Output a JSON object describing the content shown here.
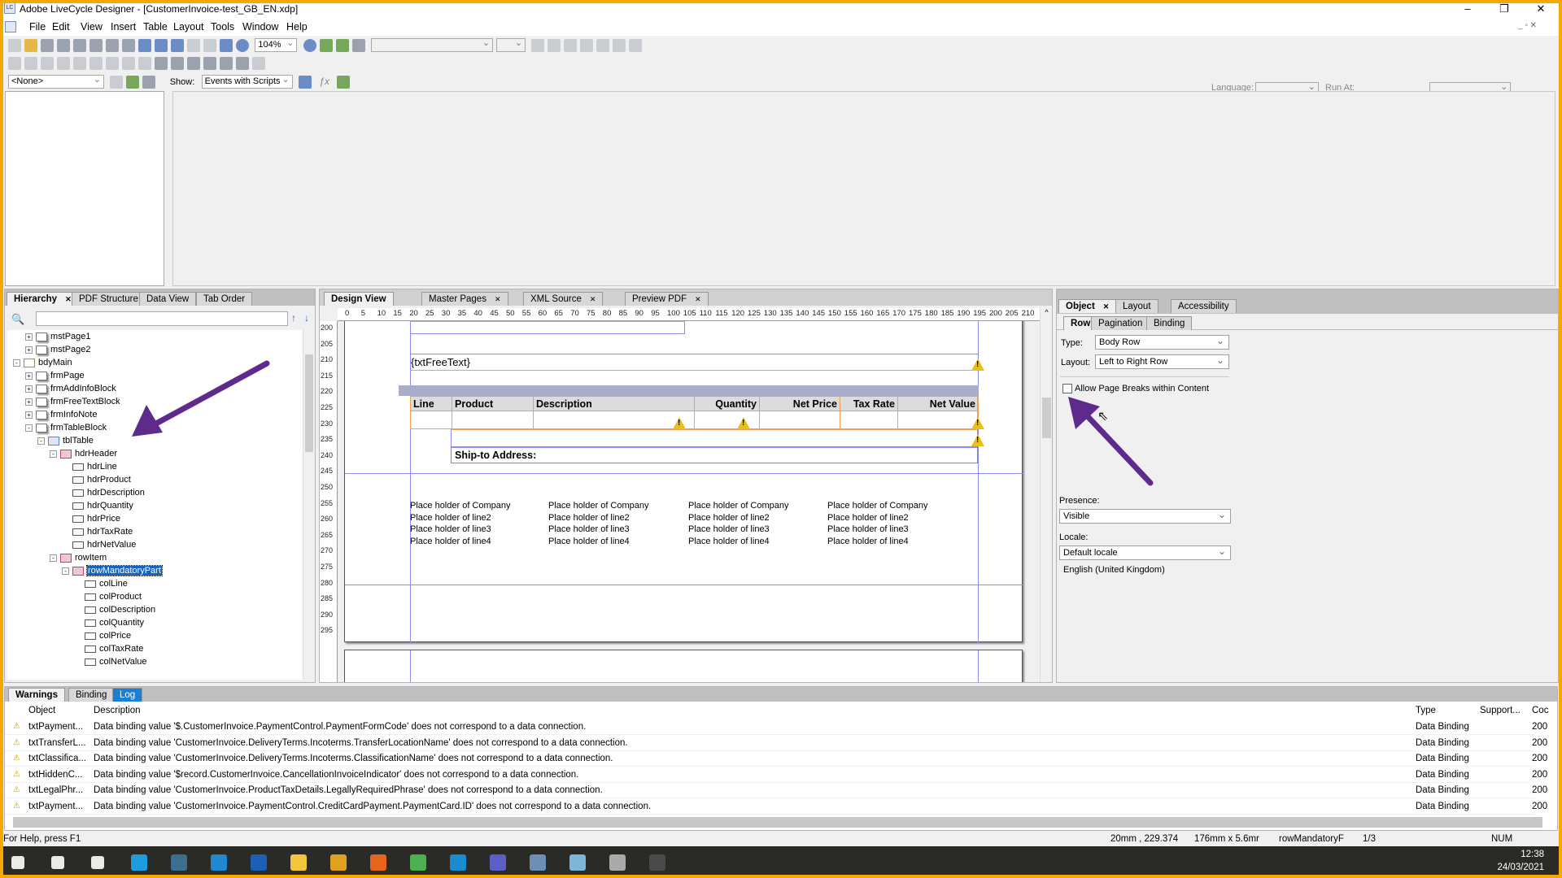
{
  "window": {
    "title": "Adobe LiveCycle Designer - [CustomerInvoice-test_GB_EN.xdp]",
    "app_icon": "LC"
  },
  "menu": [
    "File",
    "Edit",
    "View",
    "Insert",
    "Table",
    "Layout",
    "Tools",
    "Window",
    "Help"
  ],
  "toolbar": {
    "zoom": "104%"
  },
  "script_bar": {
    "object_combo": "<None>",
    "show_label": "Show:",
    "show_value": "Events with Scripts",
    "fx_label": "ƒx",
    "language_label": "Language:",
    "run_at_label": "Run At:"
  },
  "hierarchy": {
    "tabs": [
      "Hierarchy",
      "PDF Structure",
      "Data View",
      "Tab Order"
    ],
    "items": [
      {
        "label": "mstPage1",
        "level": 2,
        "toggle": "+",
        "kind": "page"
      },
      {
        "label": "mstPage2",
        "level": 2,
        "toggle": "+",
        "kind": "page"
      },
      {
        "label": "bdyMain",
        "level": 1,
        "toggle": "-",
        "kind": "doc"
      },
      {
        "label": "frmPage",
        "level": 2,
        "toggle": "+",
        "kind": "page"
      },
      {
        "label": "frmAddInfoBlock",
        "level": 2,
        "toggle": "+",
        "kind": "page"
      },
      {
        "label": "frmFreeTextBlock",
        "level": 2,
        "toggle": "+",
        "kind": "page"
      },
      {
        "label": "frmInfoNote",
        "level": 2,
        "toggle": "+",
        "kind": "page"
      },
      {
        "label": "frmTableBlock",
        "level": 2,
        "toggle": "-",
        "kind": "page"
      },
      {
        "label": "tblTable",
        "level": 3,
        "toggle": "-",
        "kind": "table"
      },
      {
        "label": "hdrHeader",
        "level": 4,
        "toggle": "-",
        "kind": "row"
      },
      {
        "label": "hdrLine",
        "level": 5,
        "toggle": "",
        "kind": "field"
      },
      {
        "label": "hdrProduct",
        "level": 5,
        "toggle": "",
        "kind": "field"
      },
      {
        "label": "hdrDescription",
        "level": 5,
        "toggle": "",
        "kind": "field"
      },
      {
        "label": "hdrQuantity",
        "level": 5,
        "toggle": "",
        "kind": "field"
      },
      {
        "label": "hdrPrice",
        "level": 5,
        "toggle": "",
        "kind": "field"
      },
      {
        "label": "hdrTaxRate",
        "level": 5,
        "toggle": "",
        "kind": "field"
      },
      {
        "label": "hdrNetValue",
        "level": 5,
        "toggle": "",
        "kind": "field"
      },
      {
        "label": "rowItem",
        "level": 4,
        "toggle": "-",
        "kind": "row"
      },
      {
        "label": "rowMandatoryPart",
        "level": 5,
        "toggle": "-",
        "kind": "row",
        "selected": true
      },
      {
        "label": "colLine",
        "level": 6,
        "toggle": "",
        "kind": "field"
      },
      {
        "label": "colProduct",
        "level": 6,
        "toggle": "",
        "kind": "field"
      },
      {
        "label": "colDescription",
        "level": 6,
        "toggle": "",
        "kind": "field"
      },
      {
        "label": "colQuantity",
        "level": 6,
        "toggle": "",
        "kind": "field"
      },
      {
        "label": "colPrice",
        "level": 6,
        "toggle": "",
        "kind": "field"
      },
      {
        "label": "colTaxRate",
        "level": 6,
        "toggle": "",
        "kind": "field"
      },
      {
        "label": "colNetValue",
        "level": 6,
        "toggle": "",
        "kind": "field"
      }
    ]
  },
  "design": {
    "tabs": [
      "Design View",
      "Master Pages",
      "XML Source",
      "Preview PDF"
    ],
    "ruler_h": [
      "0",
      "5",
      "10",
      "15",
      "20",
      "25",
      "30",
      "35",
      "40",
      "45",
      "50",
      "55",
      "60",
      "65",
      "70",
      "75",
      "80",
      "85",
      "90",
      "95",
      "100",
      "105",
      "110",
      "115",
      "120",
      "125",
      "130",
      "135",
      "140",
      "145",
      "150",
      "155",
      "160",
      "165",
      "170",
      "175",
      "180",
      "185",
      "190",
      "195",
      "200",
      "205",
      "210"
    ],
    "ruler_v": [
      "200",
      "205",
      "210",
      "215",
      "220",
      "225",
      "230",
      "235",
      "240",
      "245",
      "250",
      "255",
      "260",
      "265",
      "270",
      "275",
      "280",
      "285",
      "290",
      "295"
    ],
    "free_text": "{txtFreeText}",
    "table_headers": [
      "Line",
      "Product",
      "Description",
      "Quantity",
      "Net Price",
      "Tax Rate",
      "Net Value"
    ],
    "ship_to": "Ship-to Address:",
    "placeholders": [
      "Place holder of Company",
      "Place holder of line2",
      "Place holder of line3",
      "Place holder of line4"
    ]
  },
  "object_panel": {
    "tabs": [
      "Object",
      "Layout",
      "Accessibility"
    ],
    "subtabs": [
      "Row",
      "Pagination",
      "Binding"
    ],
    "type_label": "Type:",
    "type_value": "Body Row",
    "layout_label": "Layout:",
    "layout_value": "Left to Right Row",
    "allow_breaks_label": "Allow Page Breaks within Content",
    "allow_breaks_checked": false,
    "presence_label": "Presence:",
    "presence_value": "Visible",
    "locale_label": "Locale:",
    "locale_value": "Default locale",
    "locale_resolved": "English (United Kingdom)"
  },
  "warnings": {
    "tabs": [
      "Warnings",
      "Binding",
      "Log"
    ],
    "columns": [
      "Object",
      "Description",
      "Type",
      "Support...",
      "Coc"
    ],
    "rows": [
      {
        "object": "txtPayment...",
        "description": "Data binding value '$.CustomerInvoice.PaymentControl.PaymentFormCode' does not correspond to a data connection.",
        "type": "Data Binding",
        "support": "",
        "code": "200"
      },
      {
        "object": "txtTransferL...",
        "description": "Data binding value 'CustomerInvoice.DeliveryTerms.Incoterms.TransferLocationName' does not correspond to a data connection.",
        "type": "Data Binding",
        "support": "",
        "code": "200"
      },
      {
        "object": "txtClassifica...",
        "description": "Data binding value 'CustomerInvoice.DeliveryTerms.Incoterms.ClassificationName' does not correspond to a data connection.",
        "type": "Data Binding",
        "support": "",
        "code": "200"
      },
      {
        "object": "txtHiddenC...",
        "description": "Data binding value '$record.CustomerInvoice.CancellationInvoiceIndicator' does not correspond to a data connection.",
        "type": "Data Binding",
        "support": "",
        "code": "200"
      },
      {
        "object": "txtLegalPhr...",
        "description": "Data binding value 'CustomerInvoice.ProductTaxDetails.LegallyRequiredPhrase' does not correspond to a data connection.",
        "type": "Data Binding",
        "support": "",
        "code": "200"
      },
      {
        "object": "txtPayment...",
        "description": "Data binding value 'CustomerInvoice.PaymentControl.CreditCardPayment.PaymentCard.ID' does not correspond to a data connection.",
        "type": "Data Binding",
        "support": "",
        "code": "200"
      }
    ]
  },
  "status": {
    "help": "For Help, press F1",
    "position": "20mm , 229.374",
    "size": "176mm x 5.6mr",
    "object": "rowMandatoryF",
    "page": "1/3",
    "num": "NUM"
  },
  "taskbar": {
    "time": "12:38",
    "date": "24/03/2021",
    "icons": [
      "windows-start",
      "search",
      "task-view",
      "edge",
      "calculator",
      "internet-explorer",
      "outlook",
      "file-explorer",
      "sticky",
      "firefox",
      "chrome",
      "skype",
      "teams",
      "tool",
      "notepad",
      "printer",
      "livecycle"
    ]
  },
  "colors": {
    "accent": "#1565c0",
    "annotation_arrow": "#5e2a8c",
    "guide": "#8a8af0",
    "field_border": "#f0a050",
    "frame": "#f5a800"
  }
}
